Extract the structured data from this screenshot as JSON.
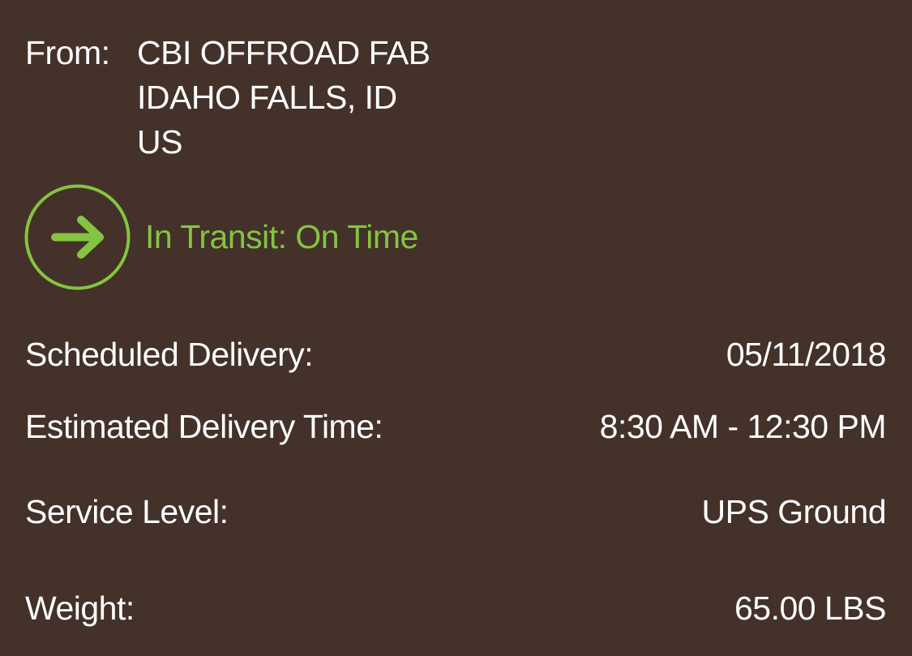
{
  "from": {
    "label": "From:",
    "lines": [
      "CBI OFFROAD FAB",
      "IDAHO FALLS, ID",
      "US"
    ]
  },
  "status": {
    "icon": "arrow-right-circle-icon",
    "text": "In Transit: On Time",
    "color": "#84c441"
  },
  "details": [
    {
      "label": "Scheduled Delivery:",
      "value": "05/11/2018"
    },
    {
      "label": "Estimated Delivery Time:",
      "value": "8:30 AM - 12:30 PM"
    },
    {
      "label": "Service Level:",
      "value": "UPS Ground"
    },
    {
      "label": "Weight:",
      "value": "65.00 LBS"
    }
  ],
  "colors": {
    "background": "#43312a",
    "text": "#ffffff",
    "accent": "#84c441"
  }
}
